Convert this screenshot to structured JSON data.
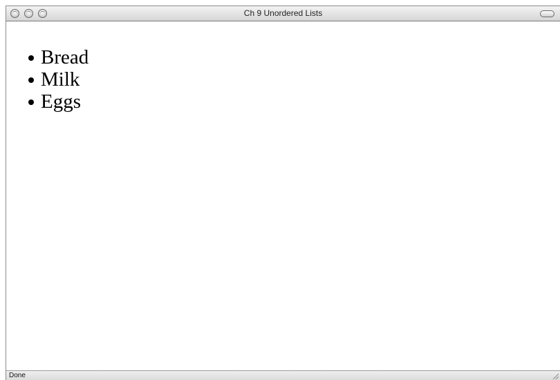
{
  "window": {
    "title": "Ch 9 Unordered Lists"
  },
  "list": {
    "items": [
      "Bread",
      "Milk",
      "Eggs"
    ]
  },
  "status": {
    "text": "Done"
  }
}
